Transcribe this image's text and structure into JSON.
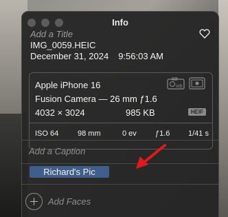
{
  "window": {
    "title": "Info"
  },
  "photo": {
    "title_placeholder": "Add a Title",
    "filename": "IMG_0059.HEIC",
    "date": "December 31, 2024",
    "time": "9:56:03 AM"
  },
  "metadata": {
    "device": "Apple iPhone 16",
    "lens": "Fusion Camera — 26 mm ƒ1.6",
    "dimensions": "4032 × 3024",
    "file_size": "985 KB",
    "format_badge": "HEIF",
    "exif": {
      "iso": "ISO 64",
      "focal_length": "98 mm",
      "exposure_bias": "0 ev",
      "aperture": "ƒ1.6",
      "shutter_speed": "1/41 s"
    }
  },
  "caption": {
    "placeholder": "Add a Caption"
  },
  "keywords": {
    "tag": "Richard's Pic"
  },
  "faces": {
    "label": "Add Faces"
  },
  "annotation": {
    "arrow_color": "#e01a1a"
  },
  "icons": {
    "favorite": "heart-icon",
    "camera_wb": "camera-wb-icon",
    "metering": "metering-icon",
    "add": "plus-circle-icon"
  }
}
